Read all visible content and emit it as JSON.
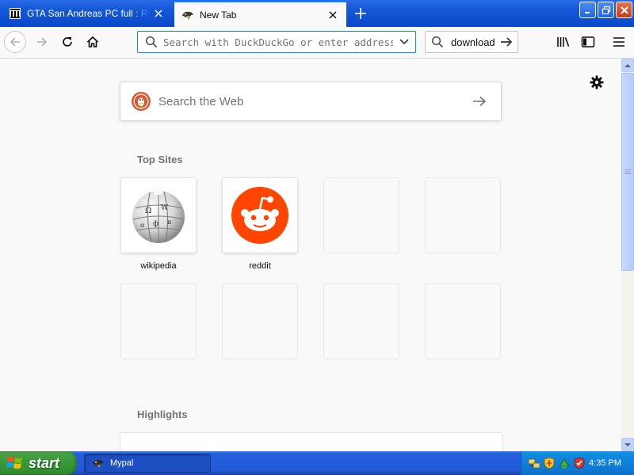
{
  "tabs": [
    {
      "title": "GTA San Andreas PC full : Rockstar Games",
      "favicon": "archive-building-icon",
      "active": false
    },
    {
      "title": "New Tab",
      "favicon": "mypal-icon",
      "active": true
    }
  ],
  "toolbar": {
    "url_placeholder": "Search with DuckDuckGo or enter address",
    "url_value": "",
    "search_box_text": "download"
  },
  "newtab": {
    "web_search_placeholder": "Search the Web",
    "top_sites_title": "Top Sites",
    "highlights_title": "Highlights",
    "top_sites": [
      {
        "label": "wikipedia",
        "icon": "wikipedia-globe-icon"
      },
      {
        "label": "reddit",
        "icon": "reddit-icon"
      },
      {
        "label": "",
        "icon": ""
      },
      {
        "label": "",
        "icon": ""
      },
      {
        "label": "",
        "icon": ""
      },
      {
        "label": "",
        "icon": ""
      },
      {
        "label": "",
        "icon": ""
      },
      {
        "label": "",
        "icon": ""
      }
    ]
  },
  "taskbar": {
    "start_label": "start",
    "task_label": "Mypal",
    "clock": "4:35 PM",
    "tray_icons": [
      "network-icon",
      "security-shield-icon",
      "safely-remove-icon",
      "antivirus-icon"
    ]
  },
  "colors": {
    "accent": "#0a84ff",
    "taskbar_blue": "#245edc",
    "start_green": "#3c9a3b",
    "reddit_orange": "#ff4500",
    "ddg_orange": "#de5833"
  }
}
